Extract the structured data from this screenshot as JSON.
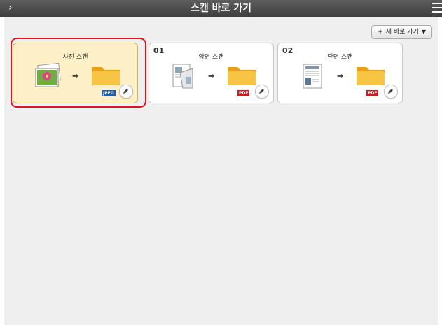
{
  "title_bar": {
    "title": "스캔 바로 가기",
    "back_icon": "chevron-right-icon",
    "menu_icon": "hamburger-menu-icon"
  },
  "toolbar": {
    "new_shortcut_label": "새 바로 가기"
  },
  "shortcuts": [
    {
      "number": "",
      "label": "사진 스캔",
      "source_icon": "photo-stack-icon",
      "format": "JPEG",
      "format_color": "#1d5fb8",
      "selected": true
    },
    {
      "number": "01",
      "label": "양면 스캔",
      "source_icon": "duplex-document-icon",
      "format": "PDF",
      "format_color": "#cc1d1d",
      "selected": false
    },
    {
      "number": "02",
      "label": "단면 스캔",
      "source_icon": "single-document-icon",
      "format": "PDF",
      "format_color": "#cc1d1d",
      "selected": false
    }
  ],
  "colors": {
    "titlebar": "#4a4a4a",
    "selection": "#e2131e",
    "selected_card": "#fdf0c6",
    "folder": "#f5b82b"
  }
}
